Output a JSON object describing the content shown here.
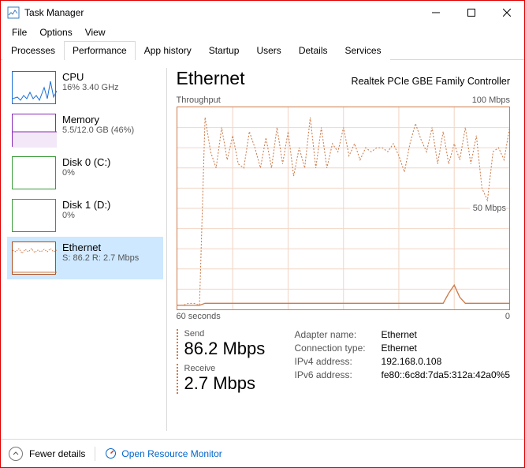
{
  "window": {
    "title": "Task Manager"
  },
  "menu": {
    "file": "File",
    "options": "Options",
    "view": "View"
  },
  "tabs": {
    "processes": "Processes",
    "performance": "Performance",
    "app_history": "App history",
    "startup": "Startup",
    "users": "Users",
    "details": "Details",
    "services": "Services"
  },
  "sidebar": {
    "cpu": {
      "title": "CPU",
      "sub": "16% 3.40 GHz"
    },
    "mem": {
      "title": "Memory",
      "sub": "5.5/12.0 GB (46%)"
    },
    "d0": {
      "title": "Disk 0 (C:)",
      "sub": "0%"
    },
    "d1": {
      "title": "Disk 1 (D:)",
      "sub": "0%"
    },
    "eth": {
      "title": "Ethernet",
      "sub": "S: 86.2 R: 2.7 Mbps"
    }
  },
  "main": {
    "title": "Ethernet",
    "adapter": "Realtek PCIe GBE Family Controller",
    "chart_top_left": "Throughput",
    "chart_top_right": "100 Mbps",
    "chart_mid": "50 Mbps",
    "chart_bot_left": "60 seconds",
    "chart_bot_right": "0"
  },
  "details": {
    "send_label": "Send",
    "send_value": "86.2 Mbps",
    "recv_label": "Receive",
    "recv_value": "2.7 Mbps",
    "adapter_name_k": "Adapter name:",
    "adapter_name_v": "Ethernet",
    "conn_type_k": "Connection type:",
    "conn_type_v": "Ethernet",
    "ipv4_k": "IPv4 address:",
    "ipv4_v": "192.168.0.108",
    "ipv6_k": "IPv6 address:",
    "ipv6_v": "fe80::6c8d:7da5:312a:42a0%5"
  },
  "footer": {
    "fewer": "Fewer details",
    "orm": "Open Resource Monitor"
  },
  "chart_data": {
    "type": "line",
    "x_seconds_ago": [
      60,
      59,
      58,
      57,
      56,
      55,
      54,
      53,
      52,
      51,
      50,
      49,
      48,
      47,
      46,
      45,
      44,
      43,
      42,
      41,
      40,
      39,
      38,
      37,
      36,
      35,
      34,
      33,
      32,
      31,
      30,
      29,
      28,
      27,
      26,
      25,
      24,
      23,
      22,
      21,
      20,
      19,
      18,
      17,
      16,
      15,
      14,
      13,
      12,
      11,
      10,
      9,
      8,
      7,
      6,
      5,
      4,
      3,
      2,
      1,
      0
    ],
    "series": [
      {
        "name": "Send (Mbps)",
        "values": [
          2,
          2,
          3,
          3,
          2,
          95,
          78,
          70,
          90,
          74,
          86,
          72,
          70,
          88,
          80,
          70,
          85,
          70,
          90,
          72,
          88,
          66,
          80,
          70,
          95,
          70,
          90,
          70,
          82,
          78,
          90,
          76,
          82,
          74,
          80,
          78,
          80,
          80,
          78,
          82,
          76,
          68,
          82,
          92,
          84,
          78,
          90,
          72,
          88,
          72,
          82,
          74,
          90,
          72,
          86,
          60,
          54,
          78,
          80,
          74,
          90
        ]
      },
      {
        "name": "Receive (Mbps)",
        "values": [
          2,
          2,
          2,
          2,
          2,
          3,
          3,
          3,
          3,
          3,
          3,
          3,
          3,
          3,
          3,
          3,
          3,
          3,
          3,
          3,
          3,
          3,
          3,
          3,
          3,
          3,
          3,
          3,
          3,
          3,
          3,
          3,
          3,
          3,
          3,
          3,
          3,
          3,
          3,
          3,
          3,
          3,
          3,
          3,
          3,
          3,
          3,
          3,
          3,
          8,
          12,
          6,
          3,
          3,
          3,
          3,
          3,
          3,
          3,
          3,
          3
        ]
      }
    ],
    "ylabel": "Throughput",
    "ylim": [
      0,
      100
    ],
    "y_unit": "Mbps",
    "xlabel": "seconds ago",
    "xlim": [
      60,
      0
    ]
  }
}
